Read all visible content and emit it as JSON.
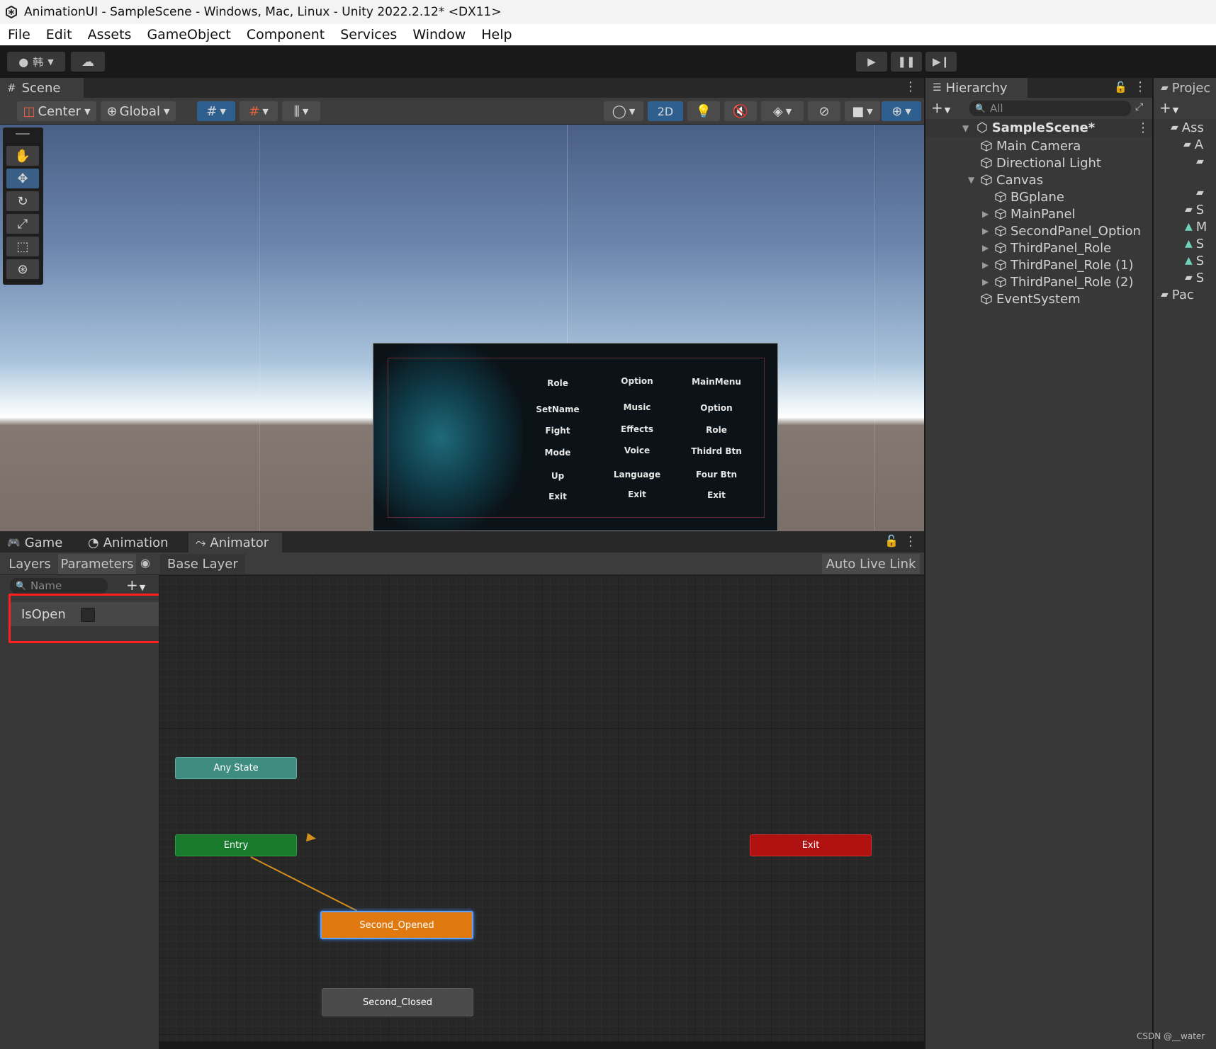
{
  "window": {
    "title": "AnimationUI - SampleScene - Windows, Mac, Linux - Unity 2022.2.12* <DX11>"
  },
  "menu": [
    "File",
    "Edit",
    "Assets",
    "GameObject",
    "Component",
    "Services",
    "Window",
    "Help"
  ],
  "toolbar": {
    "account_label": "韩"
  },
  "scene": {
    "tab_label": "Scene",
    "pivot_mode": "Center",
    "pivot_rotation": "Global",
    "btn_2d": "2D"
  },
  "game_ui": {
    "columns": [
      [
        "Role",
        "SetName",
        "Fight",
        "Mode",
        "Up",
        "Exit"
      ],
      [
        "Option",
        "Music",
        "Effects",
        "Voice",
        "Language",
        "Exit"
      ],
      [
        "MainMenu",
        "Option",
        "Role",
        "Thidrd Btn",
        "Four Btn",
        "Exit"
      ]
    ]
  },
  "bottom_tabs": {
    "game": "Game",
    "animation": "Animation",
    "animator": "Animator"
  },
  "animator": {
    "layers_tab": "Layers",
    "parameters_tab": "Parameters",
    "layer_breadcrumb": "Base Layer",
    "auto_live_link": "Auto Live Link",
    "search_placeholder": "Name",
    "parameters": [
      {
        "name": "IsOpen",
        "type": "bool",
        "value": false
      }
    ],
    "nodes": {
      "any_state": "Any State",
      "entry": "Entry",
      "exit": "Exit",
      "second_opened": "Second_Opened",
      "second_closed": "Second_Closed"
    },
    "colors": {
      "any_state": "#3f8d80",
      "entry": "#187a2c",
      "exit": "#b01111",
      "default_state": "#e07a10",
      "state": "#4a4a4a"
    }
  },
  "hierarchy": {
    "tab_label": "Hierarchy",
    "search_placeholder": "All",
    "scene_name": "SampleScene*",
    "items": [
      {
        "label": "Main Camera",
        "depth": 1,
        "expandable": false
      },
      {
        "label": "Directional Light",
        "depth": 1,
        "expandable": false
      },
      {
        "label": "Canvas",
        "depth": 1,
        "expandable": true,
        "expanded": true
      },
      {
        "label": "BGplane",
        "depth": 2,
        "expandable": false
      },
      {
        "label": "MainPanel",
        "depth": 2,
        "expandable": true
      },
      {
        "label": "SecondPanel_Option",
        "depth": 2,
        "expandable": true
      },
      {
        "label": "ThirdPanel_Role",
        "depth": 2,
        "expandable": true
      },
      {
        "label": "ThirdPanel_Role (1)",
        "depth": 2,
        "expandable": true
      },
      {
        "label": "ThirdPanel_Role (2)",
        "depth": 2,
        "expandable": true
      },
      {
        "label": "EventSystem",
        "depth": 1,
        "expandable": false
      }
    ]
  },
  "project": {
    "tab_label": "Projec",
    "items": [
      "Ass",
      "A",
      "",
      "",
      "S",
      "M",
      "S",
      "S",
      "S",
      "Pac"
    ]
  },
  "watermark": "CSDN @__water"
}
